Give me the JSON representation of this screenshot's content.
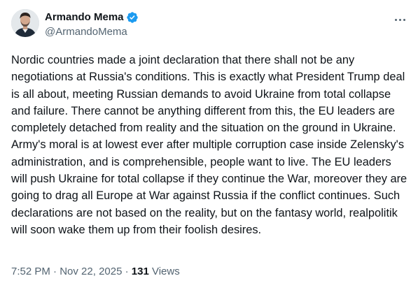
{
  "author": {
    "display_name": "Armando Mema",
    "handle": "@ArmandoMema",
    "verified": true,
    "verified_color": "#1d9bf0"
  },
  "tweet": {
    "text": "Nordic countries made a joint declaration that there shall not be any negotiations at Russia's conditions. This is exactly what President Trump deal is all about, meeting Russian demands to avoid Ukraine from total collapse and failure. There cannot be anything different from this, the EU leaders are completely detached from reality and the situation on the ground in Ukraine. Army's moral is at lowest ever after multiple corruption case inside Zelensky's administration, and is comprehensible, people want to live. The EU leaders will push Ukraine for total collapse if they continue the War, moreover they are going to drag all Europe at War against Russia if the conflict continues. Such declarations are not based on the reality, but on the fantasy world, realpolitik will soon wake them up from their foolish desires."
  },
  "meta": {
    "time": "7:52 PM",
    "separator": " · ",
    "date": "Nov 22, 2025",
    "views_count": "131",
    "views_label": " Views"
  },
  "icons": {
    "menu": "more-horizontal-icon",
    "badge": "verified-badge-icon"
  }
}
